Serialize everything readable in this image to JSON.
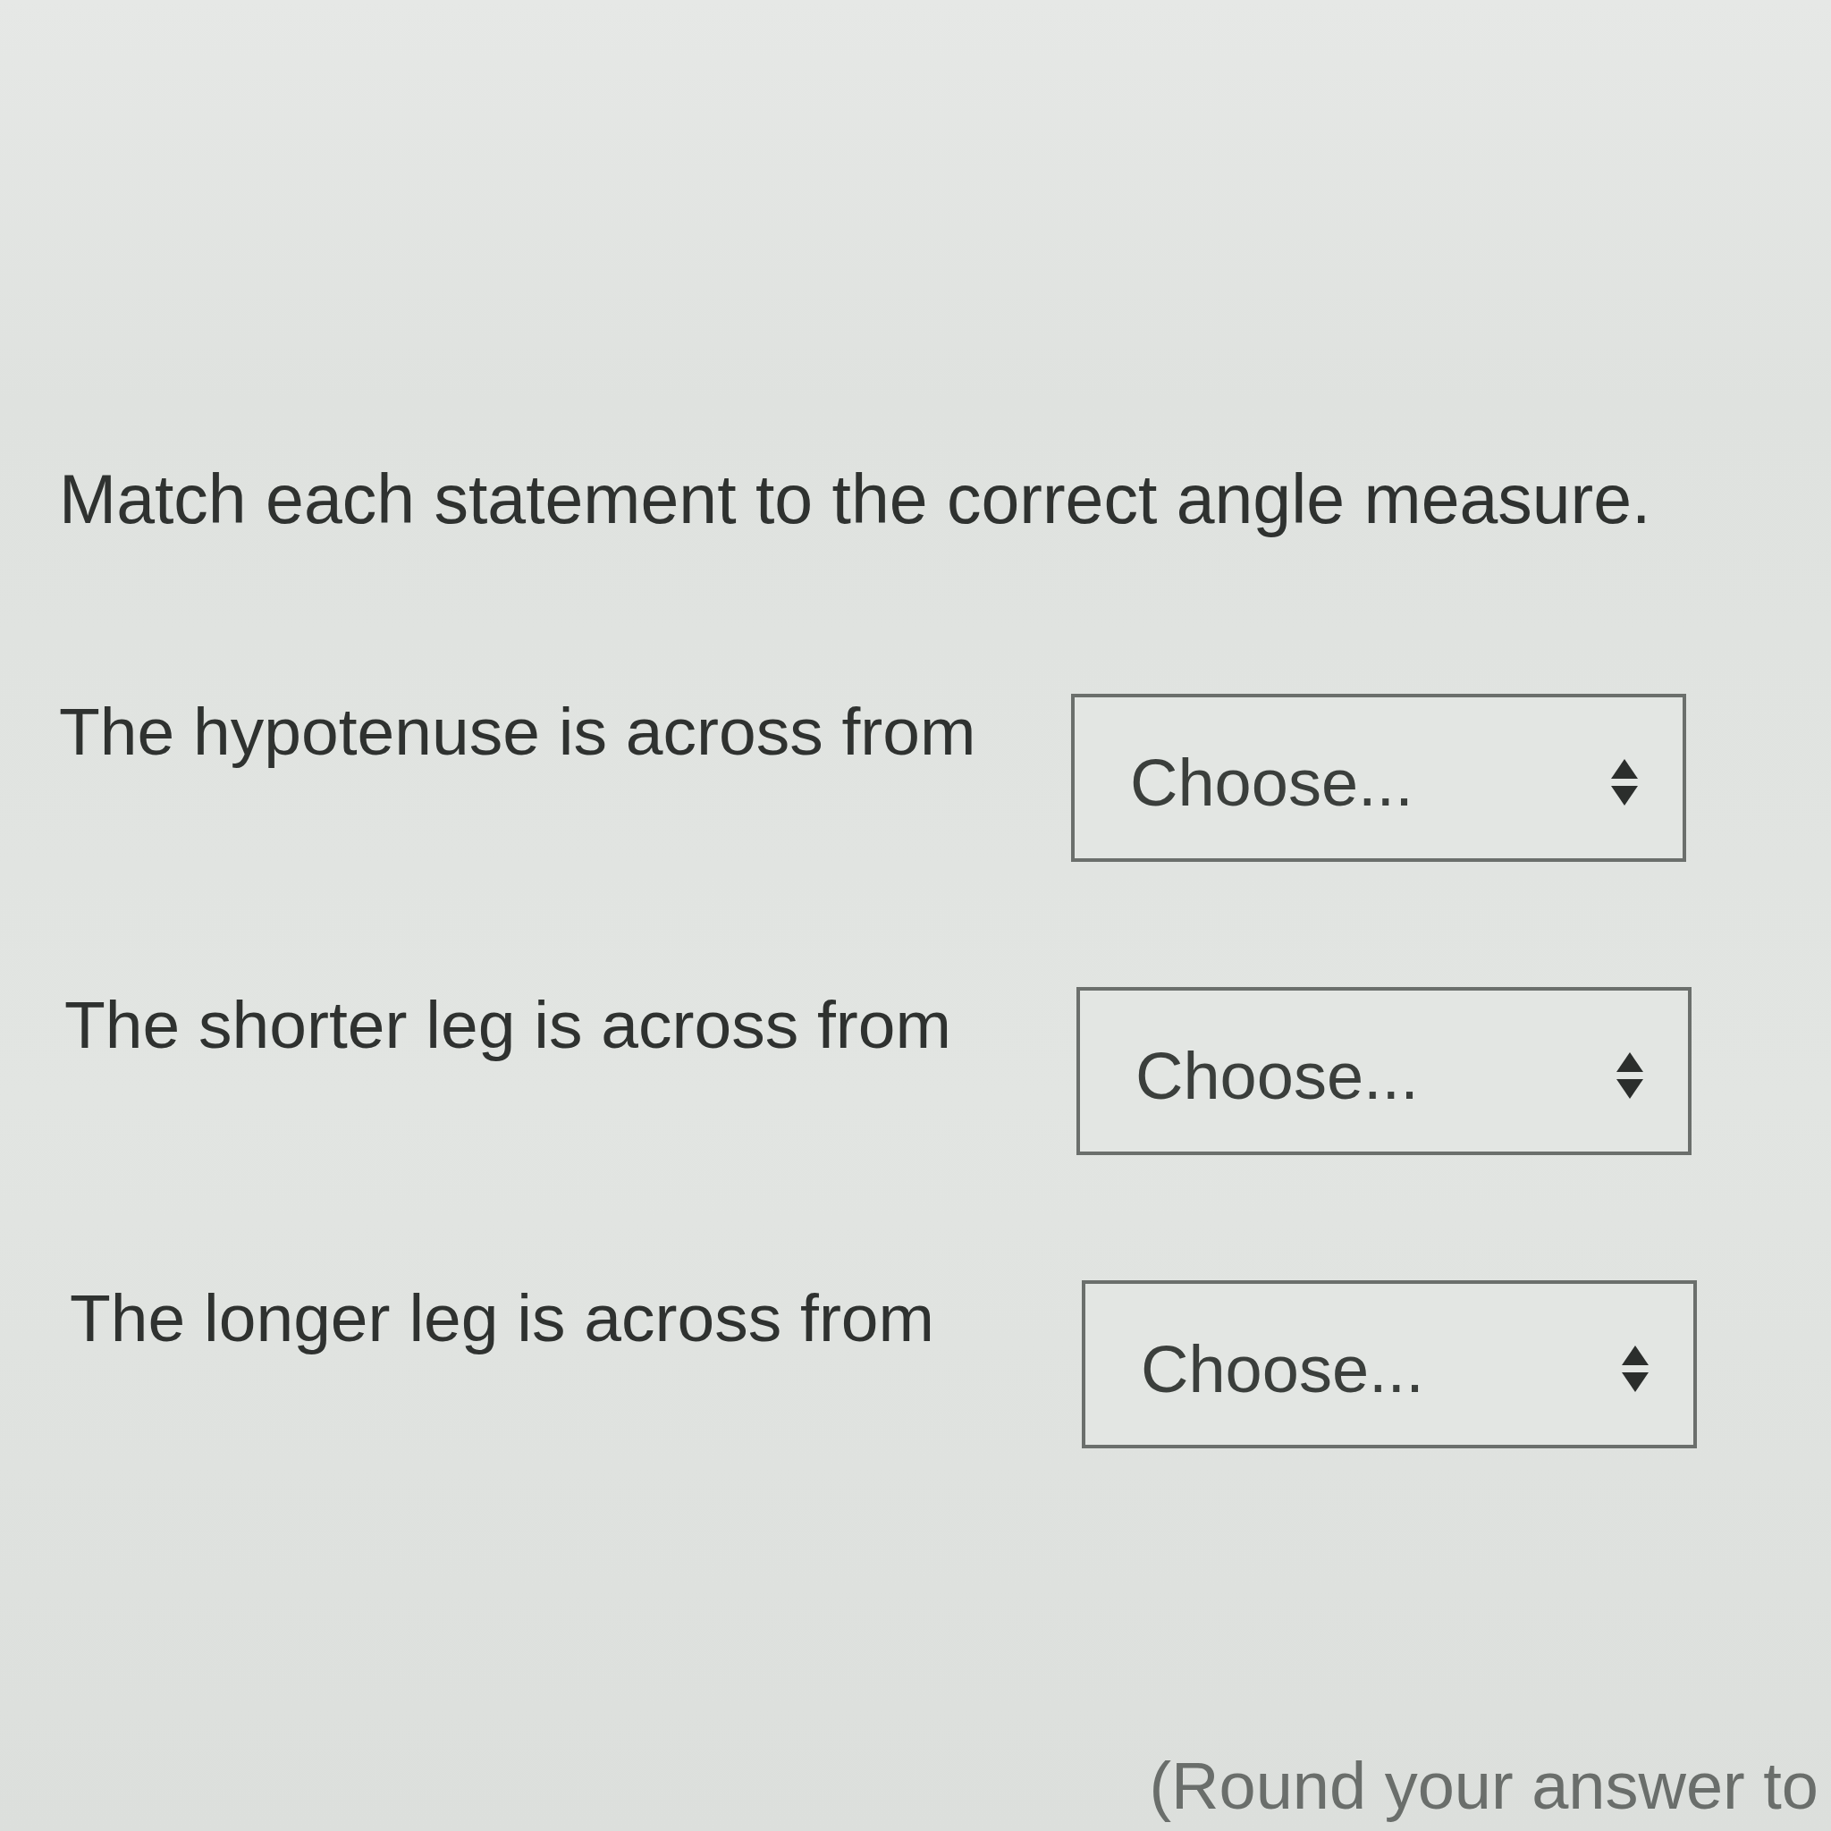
{
  "instruction": "Match each statement to the correct angle measure.",
  "items": [
    {
      "statement": "The hypotenuse is across from",
      "dropdown": {
        "placeholder": "Choose..."
      }
    },
    {
      "statement": "The shorter leg is across from",
      "dropdown": {
        "placeholder": "Choose..."
      }
    },
    {
      "statement": "The longer leg is across from",
      "dropdown": {
        "placeholder": "Choose..."
      }
    }
  ],
  "footer_text": "(Round your answer to"
}
